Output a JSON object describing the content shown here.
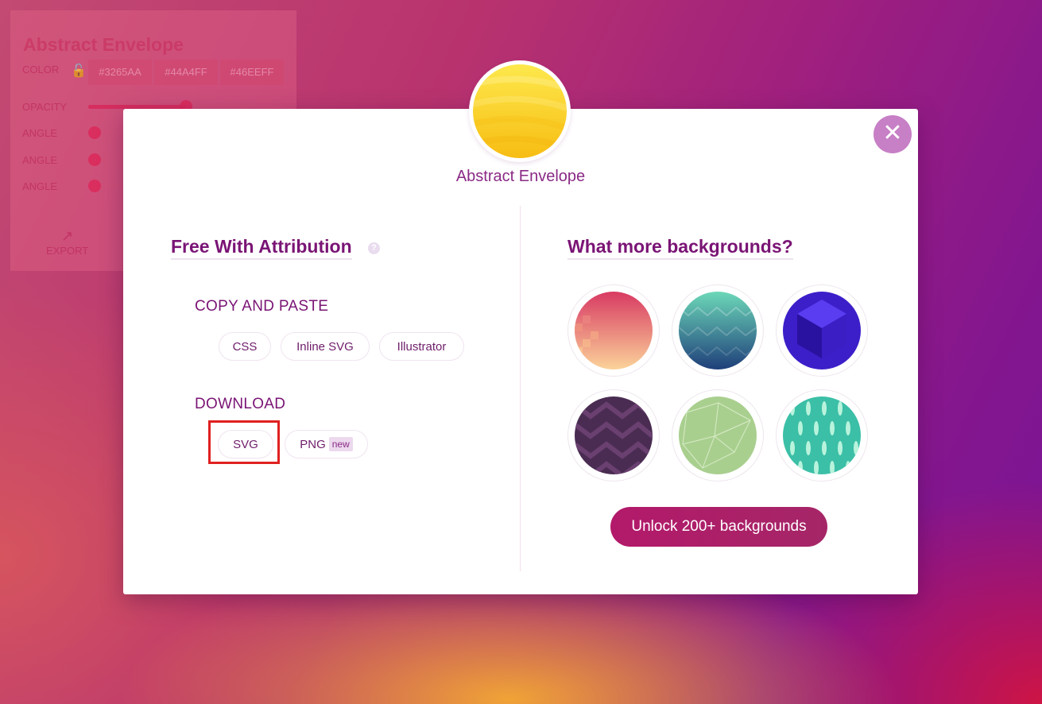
{
  "editor_panel": {
    "title": "Abstract Envelope",
    "color_label": "COLOR",
    "colors": [
      "#3265AA",
      "#44A4FF",
      "#46EEFF"
    ],
    "opacity_label": "OPACITY",
    "opacity": 0.5,
    "angle_labels": [
      "ANGLE",
      "ANGLE",
      "ANGLE"
    ],
    "export_label": "EXPORT"
  },
  "modal": {
    "pattern_name": "Abstract Envelope",
    "left": {
      "heading": "Free With Attribution",
      "copy_paste_label": "COPY AND PASTE",
      "copy_buttons": [
        "CSS",
        "Inline SVG",
        "Illustrator"
      ],
      "download_label": "DOWNLOAD",
      "download_svg": "SVG",
      "download_png": "PNG",
      "png_badge": "new"
    },
    "right": {
      "heading": "What more backgrounds?",
      "unlock_label": "Unlock 200+ backgrounds"
    }
  },
  "icons": {
    "close": "close-icon",
    "help": "question-icon",
    "lock": "lock-icon",
    "export": "external-link-icon"
  }
}
